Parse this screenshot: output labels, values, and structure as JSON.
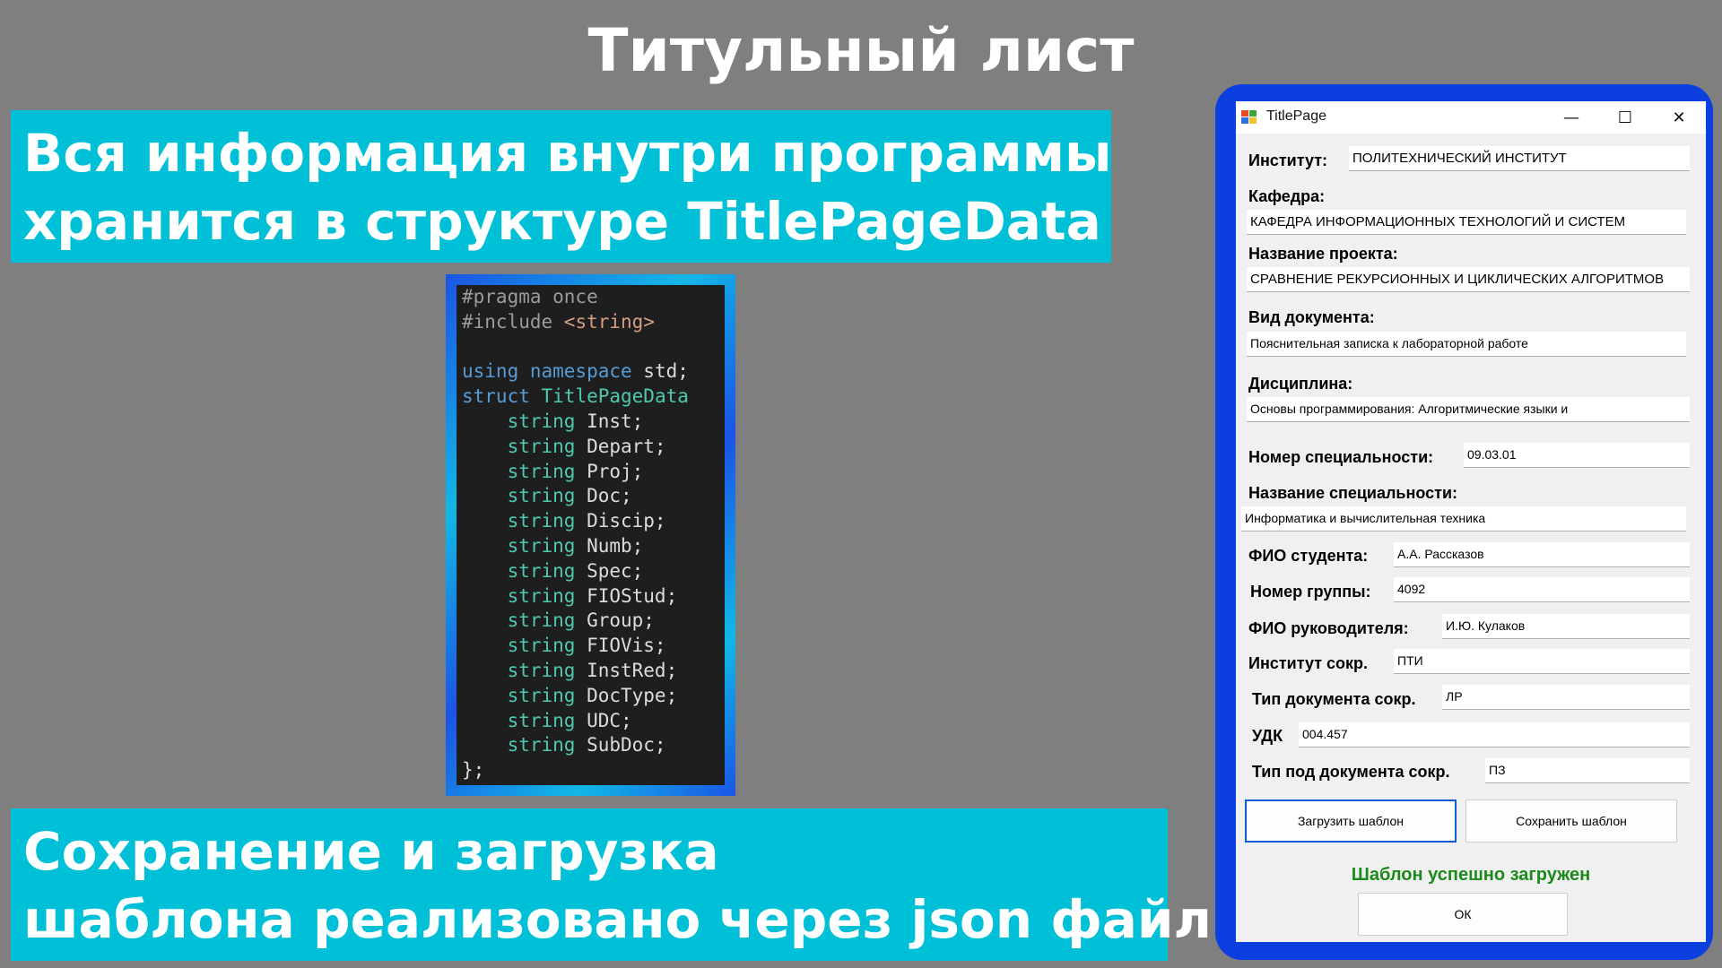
{
  "slide": {
    "title": "Титульный лист",
    "banner_top": [
      "Вся информация внутри программы",
      "хранится в структуре TitlePageData"
    ],
    "banner_bottom": [
      "Сохранение и загрузка",
      "шаблона реализовано через json файл"
    ]
  },
  "code": {
    "lines": [
      [
        {
          "t": "#pragma once",
          "c": "pre"
        }
      ],
      [
        {
          "t": "#include ",
          "c": "pre"
        },
        {
          "t": "<string>",
          "c": "str"
        }
      ],
      [],
      [
        {
          "t": "using ",
          "c": "kw"
        },
        {
          "t": "namespace ",
          "c": "kw"
        },
        {
          "t": "std;",
          "c": "id"
        }
      ],
      [
        {
          "t": "struct ",
          "c": "kw"
        },
        {
          "t": "TitlePageData",
          "c": "type"
        }
      ],
      [
        {
          "t": "    string ",
          "c": "type"
        },
        {
          "t": "Inst;",
          "c": "id"
        }
      ],
      [
        {
          "t": "    string ",
          "c": "type"
        },
        {
          "t": "Depart;",
          "c": "id"
        }
      ],
      [
        {
          "t": "    string ",
          "c": "type"
        },
        {
          "t": "Proj;",
          "c": "id"
        }
      ],
      [
        {
          "t": "    string ",
          "c": "type"
        },
        {
          "t": "Doc;",
          "c": "id"
        }
      ],
      [
        {
          "t": "    string ",
          "c": "type"
        },
        {
          "t": "Discip;",
          "c": "id"
        }
      ],
      [
        {
          "t": "    string ",
          "c": "type"
        },
        {
          "t": "Numb;",
          "c": "id"
        }
      ],
      [
        {
          "t": "    string ",
          "c": "type"
        },
        {
          "t": "Spec;",
          "c": "id"
        }
      ],
      [
        {
          "t": "    string ",
          "c": "type"
        },
        {
          "t": "FIOStud;",
          "c": "id"
        }
      ],
      [
        {
          "t": "    string ",
          "c": "type"
        },
        {
          "t": "Group;",
          "c": "id"
        }
      ],
      [
        {
          "t": "    string ",
          "c": "type"
        },
        {
          "t": "FIOVis;",
          "c": "id"
        }
      ],
      [
        {
          "t": "    string ",
          "c": "type"
        },
        {
          "t": "InstRed;",
          "c": "id"
        }
      ],
      [
        {
          "t": "    string ",
          "c": "type"
        },
        {
          "t": "DocType;",
          "c": "id"
        }
      ],
      [
        {
          "t": "    string ",
          "c": "type"
        },
        {
          "t": "UDC;",
          "c": "id"
        }
      ],
      [
        {
          "t": "    string ",
          "c": "type"
        },
        {
          "t": "SubDoc;",
          "c": "id"
        }
      ],
      [
        {
          "t": "};",
          "c": "id"
        }
      ]
    ]
  },
  "window": {
    "title": "TitlePage",
    "controls": {
      "minimize": "—",
      "maximize": "☐",
      "close": "✕"
    },
    "fields": {
      "institute": {
        "label": "Институт:",
        "value": "ПОЛИТЕХНИЧЕСКИЙ ИНСТИТУТ"
      },
      "department": {
        "label": "Кафедра:",
        "value": "КАФЕДРА ИНФОРМАЦИОННЫХ ТЕХНОЛОГИЙ И СИСТЕМ"
      },
      "project": {
        "label": "Название проекта:",
        "value": "СРАВНЕНИЕ РЕКУРСИОННЫХ И ЦИКЛИЧЕСКИХ АЛГОРИТМОВ"
      },
      "doc_type": {
        "label": "Вид документа:",
        "value": "Пояснительная записка к лабораторной работе"
      },
      "discipline": {
        "label": "Дисциплина:",
        "value": "Основы программирования: Алгоритмические языки и"
      },
      "spec_number": {
        "label": "Номер специальности:",
        "value": "09.03.01"
      },
      "spec_name": {
        "label": "Название специальности:",
        "value": "Информатика и вычислительная техника"
      },
      "student": {
        "label": "ФИО студента:",
        "value": "А.А. Рассказов"
      },
      "group": {
        "label": "Номер группы:",
        "value": "4092"
      },
      "supervisor": {
        "label": "ФИО руководителя:",
        "value": "И.Ю. Кулаков"
      },
      "institute_short": {
        "label": "Институт сокр.",
        "value": "ПТИ"
      },
      "doc_type_short": {
        "label": "Тип документа сокр.",
        "value": "ЛР"
      },
      "udc": {
        "label": "УДК",
        "value": "004.457"
      },
      "subdoc_short": {
        "label": "Тип под документа сокр.",
        "value": "ПЗ"
      }
    },
    "buttons": {
      "load": "Загрузить шаблон",
      "save": "Сохранить шаблон",
      "ok": "ОК"
    },
    "status": "Шаблон успешно загружен"
  }
}
